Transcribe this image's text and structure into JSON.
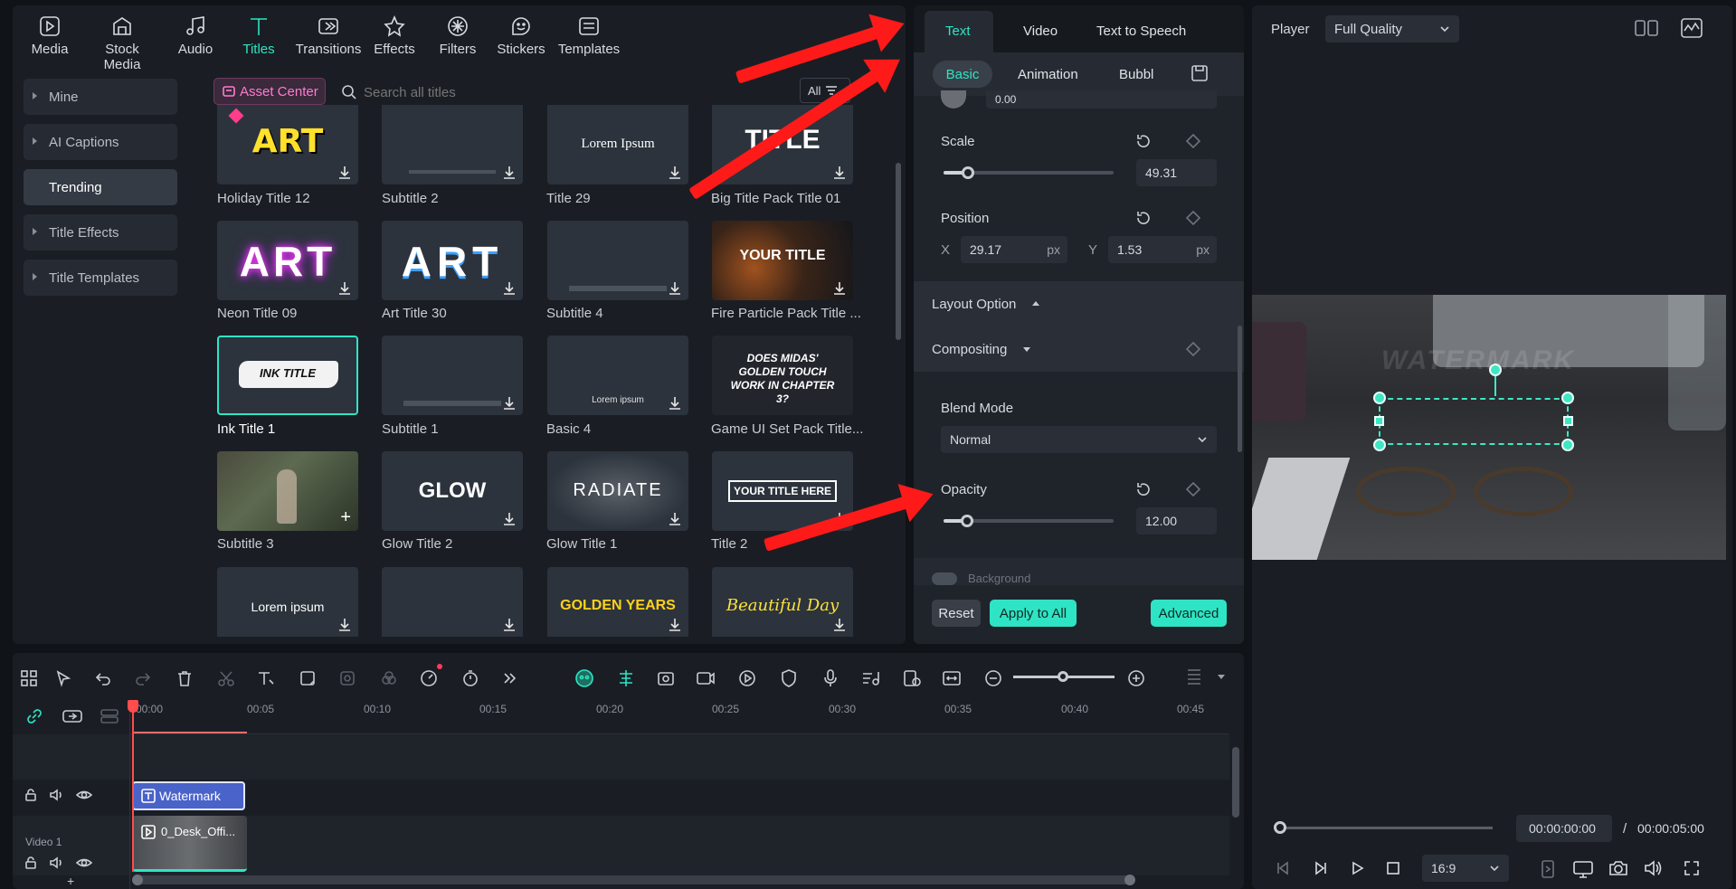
{
  "toolbar": {
    "items": [
      {
        "label": "Media",
        "icon": "media-icon"
      },
      {
        "label": "Stock Media",
        "icon": "stock-media-icon"
      },
      {
        "label": "Audio",
        "icon": "audio-icon"
      },
      {
        "label": "Titles",
        "icon": "titles-icon"
      },
      {
        "label": "Transitions",
        "icon": "transitions-icon"
      },
      {
        "label": "Effects",
        "icon": "effects-icon"
      },
      {
        "label": "Filters",
        "icon": "filters-icon"
      },
      {
        "label": "Stickers",
        "icon": "stickers-icon"
      },
      {
        "label": "Templates",
        "icon": "templates-icon"
      }
    ],
    "active": "Titles"
  },
  "sidebar": {
    "items": [
      {
        "label": "Mine"
      },
      {
        "label": "AI Captions"
      },
      {
        "label": "Trending"
      },
      {
        "label": "Title Effects"
      },
      {
        "label": "Title Templates"
      }
    ],
    "active": "Trending"
  },
  "library": {
    "asset_center": "Asset Center",
    "search_placeholder": "Search all titles",
    "filter_label": "All",
    "titles": [
      {
        "name": "Holiday Title 12",
        "preview": "ART"
      },
      {
        "name": "Subtitle 2",
        "preview": ""
      },
      {
        "name": "Title 29",
        "preview": "Lorem Ipsum"
      },
      {
        "name": "Big Title Pack Title 01",
        "preview": "TITLE"
      },
      {
        "name": "Neon Title 09",
        "preview": "ART"
      },
      {
        "name": "Art Title 30",
        "preview": "ART"
      },
      {
        "name": "Subtitle 4",
        "preview": ""
      },
      {
        "name": "Fire Particle Pack Title ...",
        "preview": "YOUR TITLE"
      },
      {
        "name": "Ink Title 1",
        "preview": "INK TITLE"
      },
      {
        "name": "Subtitle 1",
        "preview": ""
      },
      {
        "name": "Basic 4",
        "preview": "Lorem ipsum"
      },
      {
        "name": "Game UI Set Pack Title...",
        "preview": "DOES MIDAS' GOLDEN TOUCH WORK IN CHAPTER 3?"
      },
      {
        "name": "Subtitle 3",
        "preview": ""
      },
      {
        "name": "Glow Title 2",
        "preview": "GLOW"
      },
      {
        "name": "Glow Title 1",
        "preview": "RADIATE"
      },
      {
        "name": "Title 2",
        "preview": "YOUR TITLE HERE"
      },
      {
        "name": "",
        "preview": "Lorem ipsum"
      },
      {
        "name": "",
        "preview": ""
      },
      {
        "name": "",
        "preview": "GOLDEN YEARS"
      },
      {
        "name": "",
        "preview": "Beautiful Day"
      }
    ]
  },
  "properties": {
    "tabs": [
      "Text",
      "Video",
      "Text to Speech"
    ],
    "active_tab": "Text",
    "subtabs": [
      "Basic",
      "Animation",
      "Bubble"
    ],
    "active_subtab": "Basic",
    "top_value": "0.00",
    "scale": {
      "label": "Scale",
      "value": "49.31",
      "fraction": 0.12
    },
    "position": {
      "label": "Position",
      "x_label": "X",
      "x_value": "29.17",
      "y_label": "Y",
      "y_value": "1.53",
      "unit": "px"
    },
    "layout_option": "Layout Option",
    "compositing": "Compositing",
    "blend_mode": {
      "label": "Blend Mode",
      "value": "Normal"
    },
    "opacity": {
      "label": "Opacity",
      "value": "12.00",
      "fraction": 0.12
    },
    "background": "Background",
    "buttons": {
      "reset": "Reset",
      "apply_all": "Apply to All",
      "advanced": "Advanced"
    }
  },
  "player": {
    "label": "Player",
    "quality": "Full Quality",
    "watermark_text": "WATERMARK",
    "current_time": "00:00:00:00",
    "separator": "/",
    "total_time": "00:00:05:00",
    "aspect": "16:9"
  },
  "timeline": {
    "ruler": [
      "00:00",
      "00:05",
      "00:10",
      "00:15",
      "00:20",
      "00:25",
      "00:30",
      "00:35",
      "00:40",
      "00:45"
    ],
    "clips": {
      "title_clip": "Watermark",
      "video_clip": "0_Desk_Offi..."
    },
    "track_label": "Video 1"
  },
  "colors": {
    "accent": "#2fe4c4",
    "annotation": "#ff1a1a",
    "clip_title": "#4a63c9"
  }
}
